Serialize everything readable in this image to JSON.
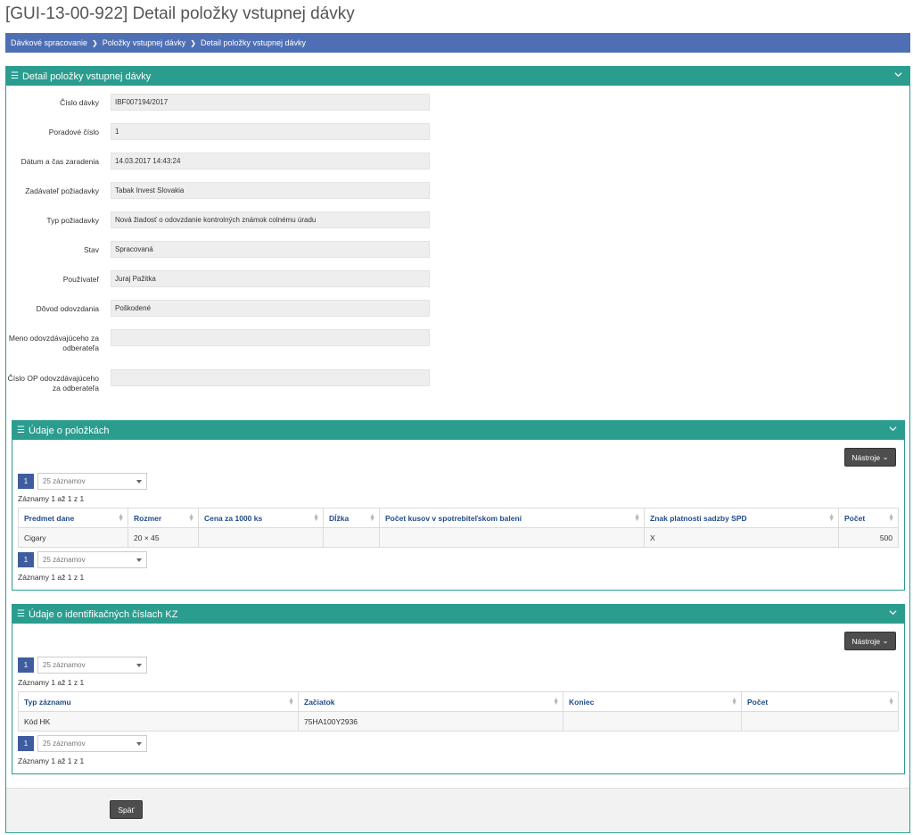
{
  "page": {
    "title": "[GUI-13-00-922] Detail položky vstupnej dávky"
  },
  "breadcrumb": [
    "Dávkové spracovanie",
    "Položky vstupnej dávky",
    "Detail položky vstupnej dávky"
  ],
  "main_panel": {
    "title": "Detail položky vstupnej dávky",
    "fields": [
      {
        "label": "Číslo dávky",
        "value": "IBF007194/2017"
      },
      {
        "label": "Poradové číslo",
        "value": "1"
      },
      {
        "label": "Dátum a čas zaradenia",
        "value": "14.03.2017 14:43:24"
      },
      {
        "label": "Zadávateľ požiadavky",
        "value": "Tabak Invest Slovakia"
      },
      {
        "label": "Typ požiadavky",
        "value": "Nová žiadosť o odovzdanie kontrolných známok colnému úradu"
      },
      {
        "label": "Stav",
        "value": "Spracovaná"
      },
      {
        "label": "Používateľ",
        "value": "Juraj Pažitka"
      },
      {
        "label": "Dôvod odovzdania",
        "value": "Poškodené"
      },
      {
        "label": "Meno odovzdávajúceho za odberateľa",
        "value": ""
      },
      {
        "label": "Číslo OP odovzdávajúceho za odberateľa",
        "value": ""
      }
    ]
  },
  "items_panel": {
    "title": "Údaje o položkách",
    "tools_label": "Nástroje",
    "page_number": "1",
    "page_size": "25 záznamov",
    "records_info": "Záznamy 1 až 1 z 1",
    "columns": [
      "Predmet dane",
      "Rozmer",
      "Cena za 1000 ks",
      "Dĺžka",
      "Počet kusov v spotrebiteľskom balení",
      "Znak platnosti sadzby SPD",
      "Počet"
    ],
    "rows": [
      [
        "Cigary",
        "20 × 45",
        "",
        "",
        "",
        "X",
        "500"
      ]
    ]
  },
  "kz_panel": {
    "title": "Údaje o identifikačných číslach KZ",
    "tools_label": "Nástroje",
    "page_number": "1",
    "page_size": "25 záznamov",
    "records_info": "Záznamy 1 až 1 z 1",
    "columns": [
      "Typ záznamu",
      "Začiatok",
      "Koniec",
      "Počet"
    ],
    "rows": [
      [
        "Kód HK",
        "75HA100Y2936",
        "",
        ""
      ]
    ]
  },
  "footer": {
    "back_label": "Späť"
  },
  "colors": {
    "panel_header": "#2a9d8f",
    "breadcrumb": "#4f6fb4",
    "button_dark": "#4d4d4d",
    "column_header_text": "#1f4b8a"
  },
  "icons": {
    "panel_toggle": "hamburger-icon",
    "collapse": "chevron-down-icon",
    "tools_caret": "caret-down-icon"
  }
}
